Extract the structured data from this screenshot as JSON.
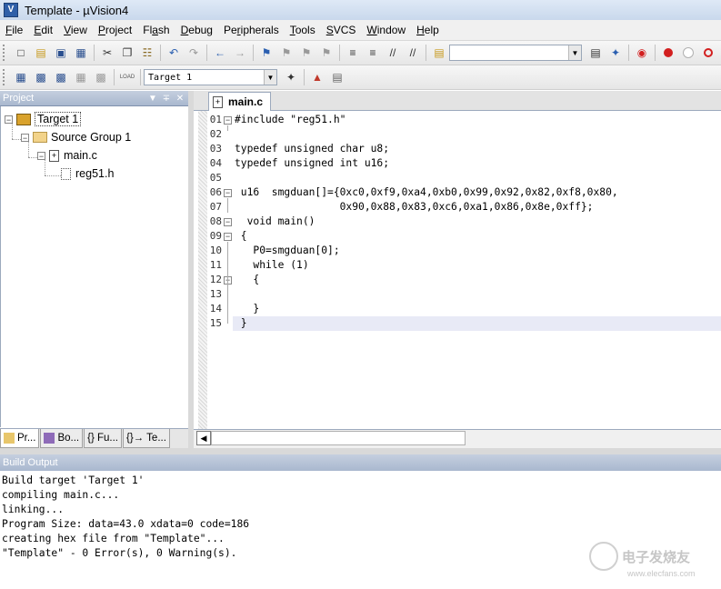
{
  "window": {
    "title": "Template - µVision4",
    "app_icon": "uvision-icon"
  },
  "menu": [
    {
      "pre": "",
      "u": "F",
      "post": "ile"
    },
    {
      "pre": "",
      "u": "E",
      "post": "dit"
    },
    {
      "pre": "",
      "u": "V",
      "post": "iew"
    },
    {
      "pre": "",
      "u": "P",
      "post": "roject"
    },
    {
      "pre": "Fl",
      "u": "a",
      "post": "sh"
    },
    {
      "pre": "",
      "u": "D",
      "post": "ebug"
    },
    {
      "pre": "Pe",
      "u": "r",
      "post": "ipherals"
    },
    {
      "pre": "",
      "u": "T",
      "post": "ools"
    },
    {
      "pre": "",
      "u": "S",
      "post": "VCS"
    },
    {
      "pre": "",
      "u": "W",
      "post": "indow"
    },
    {
      "pre": "",
      "u": "H",
      "post": "elp"
    }
  ],
  "toolbar2": {
    "target_select": "Target 1"
  },
  "project_panel": {
    "title": "Project",
    "tree": {
      "target": "Target 1",
      "group": "Source Group 1",
      "file": "main.c",
      "include": "reg51.h"
    },
    "bottom_tabs": [
      "Pr...",
      "Bo...",
      "{} Fu...",
      "{}→ Te..."
    ]
  },
  "editor": {
    "tab": "main.c",
    "line_numbers": [
      "01",
      "02",
      "03",
      "04",
      "05",
      "06",
      "07",
      "08",
      "09",
      "10",
      "11",
      "12",
      "13",
      "14",
      "15"
    ],
    "lines": [
      "#include \"reg51.h\"",
      "",
      "typedef unsigned char u8;",
      "typedef unsigned int u16;",
      "",
      " u16  smgduan[]={0xc0,0xf9,0xa4,0xb0,0x99,0x92,0x82,0xf8,0x80,",
      "                 0x90,0x88,0x83,0xc6,0xa1,0x86,0x8e,0xff};",
      "  void main()",
      " {",
      "   P0=smgduan[0];",
      "   while (1)",
      "   {",
      "",
      "   }",
      " }"
    ]
  },
  "build_output": {
    "title": "Build Output",
    "lines": [
      "Build target 'Target 1'",
      "compiling main.c...",
      "linking...",
      "Program Size: data=43.0 xdata=0 code=186",
      "creating hex file from \"Template\"...",
      "\"Template\" - 0 Error(s), 0 Warning(s)."
    ]
  },
  "watermark": {
    "name": "电子发烧友",
    "url": "www.elecfans.com"
  },
  "colors": {
    "panel_header": "#a9b8cf",
    "current_line": "#e8eaf6",
    "breakpoint": "#d21f1f"
  }
}
